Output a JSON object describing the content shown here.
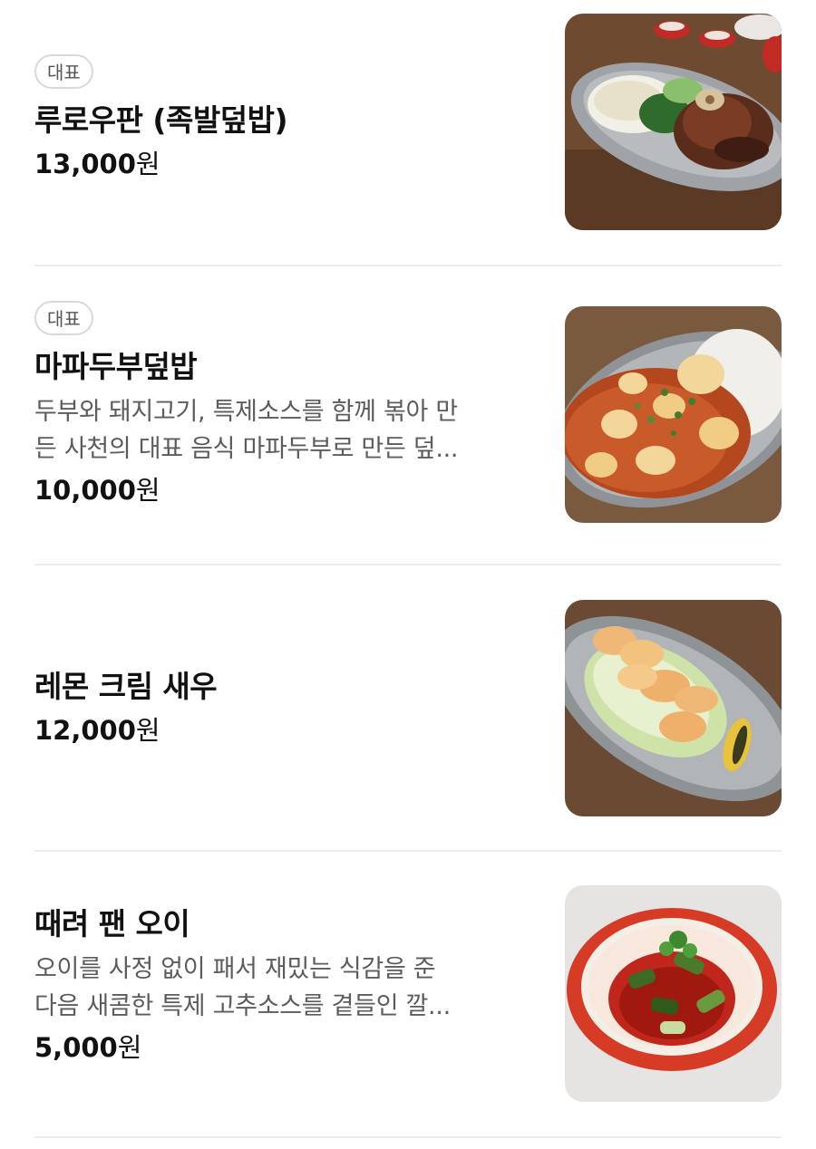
{
  "menu": {
    "items": [
      {
        "badge": "대표",
        "name": "루로우판 (족발덮밥)",
        "description_lines": [],
        "price_number": "13,000",
        "price_unit": "원",
        "photo": "braised-pork-knuckle-rice-photo"
      },
      {
        "badge": "대표",
        "name": "마파두부덮밥",
        "description_lines": [
          "두부와 돼지고기, 특제소스를 함께 볶아 만",
          "든 사천의 대표 음식 마파두부로 만든 덮..."
        ],
        "price_number": "10,000",
        "price_unit": "원",
        "photo": "mapo-tofu-rice-photo"
      },
      {
        "badge": "",
        "name": "레몬 크림 새우",
        "description_lines": [],
        "price_number": "12,000",
        "price_unit": "원",
        "photo": "lemon-cream-shrimp-photo"
      },
      {
        "badge": "",
        "name": "때려 팬 오이",
        "description_lines": [
          "오이를 사정 없이 패서 재밌는 식감을 준",
          "다음 새콤한 특제 고추소스를 곁들인 깔..."
        ],
        "price_number": "5,000",
        "price_unit": "원",
        "photo": "smashed-cucumber-salad-photo"
      }
    ]
  }
}
